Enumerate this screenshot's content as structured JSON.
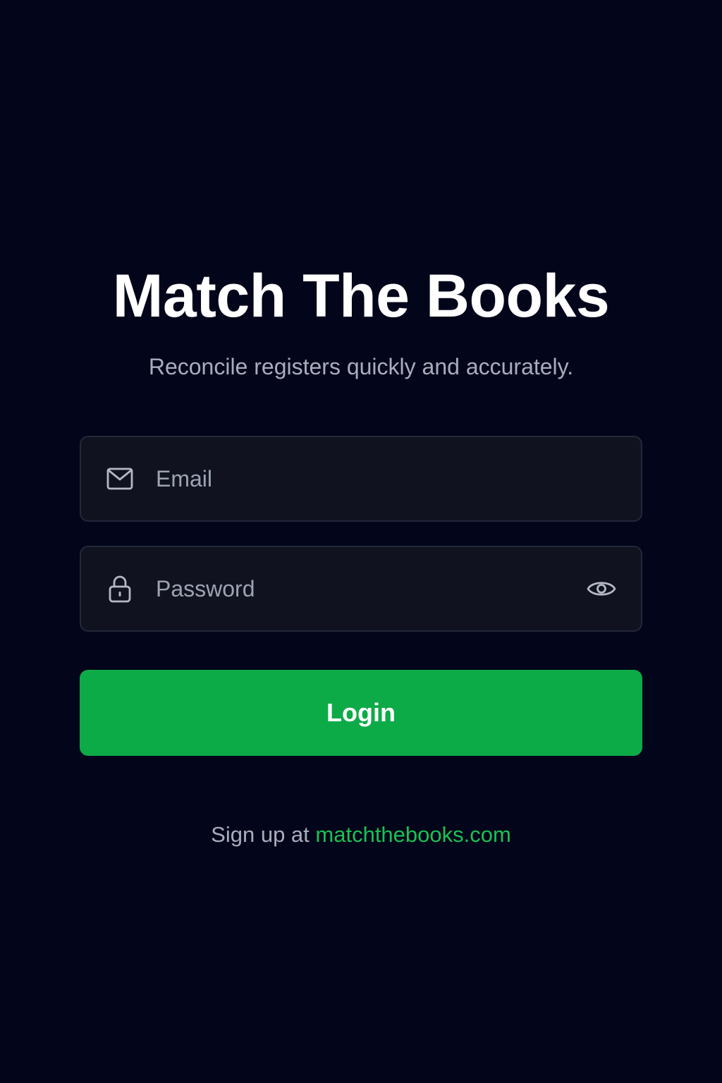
{
  "app": {
    "title": "Match The Books",
    "subtitle": "Reconcile registers quickly and accurately."
  },
  "form": {
    "email": {
      "placeholder": "Email",
      "value": "",
      "icon": "mail-icon"
    },
    "password": {
      "placeholder": "Password",
      "value": "",
      "icon": "lock-icon",
      "toggle_icon": "eye-icon"
    },
    "login_label": "Login"
  },
  "signup": {
    "prefix": "Sign up at",
    "link_text": "matchthebooks.com"
  },
  "colors": {
    "background": "#03051a",
    "accent": "#0dab48",
    "link": "#19c253",
    "field_bg": "#10131f"
  }
}
